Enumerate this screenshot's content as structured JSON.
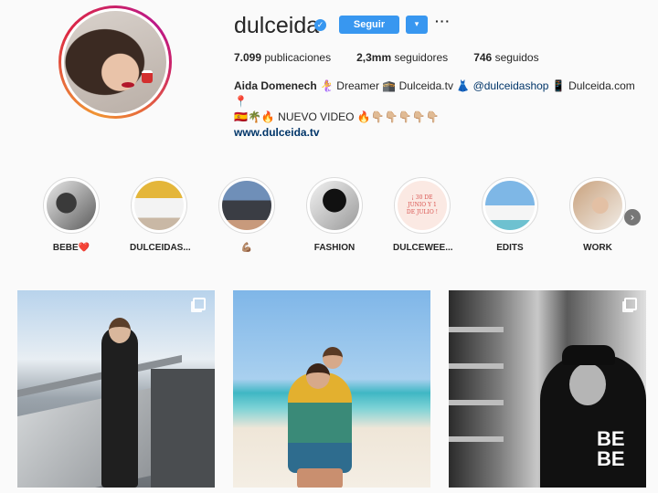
{
  "profile": {
    "username": "dulceida",
    "follow_label": "Seguir",
    "dropdown_glyph": "▾",
    "more_glyph": "···",
    "stats": {
      "posts_count": "7.099",
      "posts_label": "publicaciones",
      "followers_count": "2,3mm",
      "followers_label": "seguidores",
      "following_count": "746",
      "following_label": "seguidos"
    },
    "bio": {
      "name": "Aida Domenech",
      "line1_rest": " 🧜‍♀️ Dreamer 🕋 Dulceida.tv 👗 ",
      "mention": "@dulceidashop",
      "line1_tail": " 📱 Dulceida.com 📍",
      "line2": "🇪🇸🌴🔥 NUEVO VIDEO 🔥👇🏼👇🏼👇🏼👇🏼👇🏼",
      "website": "www.dulceida.tv"
    }
  },
  "highlights": [
    {
      "label": "BEBE❤️"
    },
    {
      "label": "DULCEIDAS..."
    },
    {
      "label": "💪🏽"
    },
    {
      "label": "FASHION"
    },
    {
      "label": "DULCEWEE..."
    },
    {
      "label": "EDITS"
    },
    {
      "label": "WORK"
    }
  ],
  "highlight_thumbs": {
    "dulceweekend_text": "¡ 30 DE JUNIO Y 1 DE JULIO !"
  },
  "posts": [
    {
      "type": "multi"
    },
    {
      "type": "single"
    },
    {
      "type": "multi",
      "overlay_text": "BE BE"
    }
  ],
  "colors": {
    "accent": "#3897f0",
    "text": "#262626",
    "link": "#003569",
    "background": "#fafafa"
  }
}
